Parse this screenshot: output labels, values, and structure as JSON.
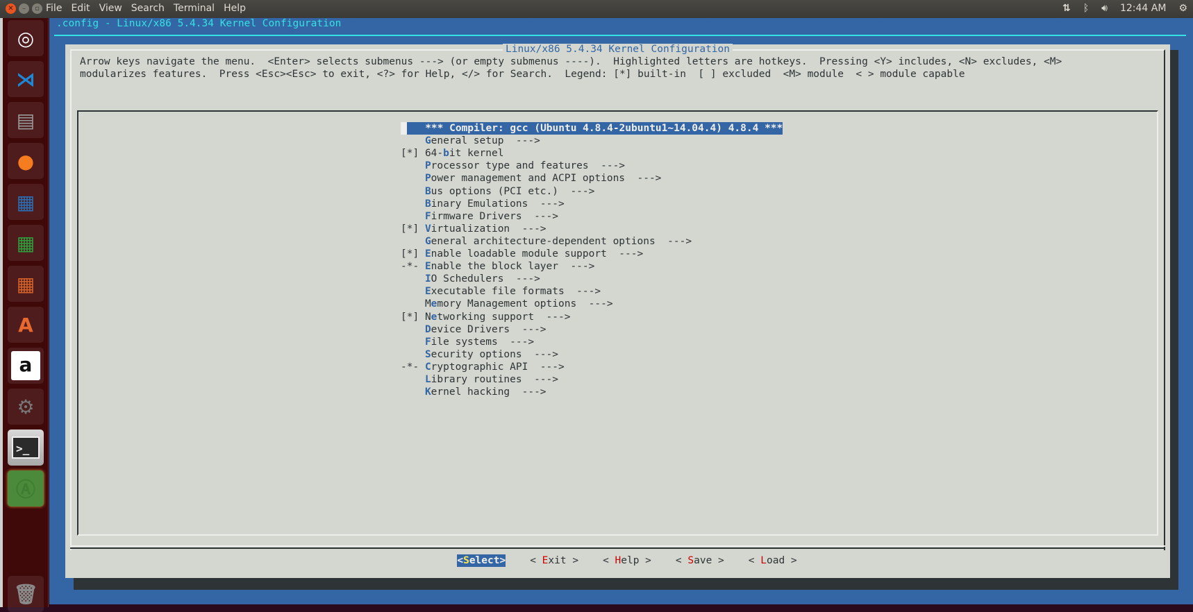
{
  "topbar": {
    "menus": [
      "File",
      "Edit",
      "View",
      "Search",
      "Terminal",
      "Help"
    ],
    "tray": {
      "network_icon": "network-updown-icon",
      "bluetooth_icon": "bluetooth-icon",
      "volume_icon": "volume-icon",
      "clock": "12:44 AM",
      "power_icon": "power-gear-icon"
    }
  },
  "launcher": {
    "items": [
      {
        "name": "ubuntu-dash",
        "icon": "ubuntu-logo-icon",
        "color": "#b03a3a"
      },
      {
        "name": "vscode",
        "icon": "vscode-icon",
        "color": "#1e88d8"
      },
      {
        "name": "files",
        "icon": "file-cabinet-icon",
        "color": "#9a9a9a"
      },
      {
        "name": "firefox",
        "icon": "firefox-icon",
        "color": "#f57c1f"
      },
      {
        "name": "libreoffice-writer",
        "icon": "writer-icon",
        "color": "#2a6fb5"
      },
      {
        "name": "libreoffice-calc",
        "icon": "calc-icon",
        "color": "#2f9e3c"
      },
      {
        "name": "libreoffice-impress",
        "icon": "impress-icon",
        "color": "#d4632a"
      },
      {
        "name": "software-center",
        "icon": "shopping-bag-icon",
        "color": "#e8692d"
      },
      {
        "name": "amazon",
        "icon": "amazon-icon",
        "color": "#dddddd"
      },
      {
        "name": "system-settings",
        "icon": "settings-wrench-icon",
        "color": "#777777"
      },
      {
        "name": "terminal",
        "icon": "terminal-icon",
        "color": "#2b2b2b"
      },
      {
        "name": "software-updater",
        "icon": "updater-icon",
        "color": "#3f7d32"
      },
      {
        "name": "trash",
        "icon": "trash-icon",
        "color": "#8a8a8a"
      }
    ]
  },
  "window": {
    "title": ".config - Linux/x86 5.4.34 Kernel Configuration"
  },
  "dialog": {
    "title": "Linux/x86 5.4.34 Kernel Configuration",
    "help_lines": [
      "Arrow keys navigate the menu.  <Enter> selects submenus ---> (or empty submenus ----).  Highlighted letters are hotkeys.  Pressing <Y> includes, <N> excludes, <M>",
      "modularizes features.  Press <Esc><Esc> to exit, <?> for Help, </> for Search.  Legend: [*] built-in  [ ] excluded  <M> module  < > module capable"
    ],
    "selected_item": "*** Compiler: gcc (Ubuntu 4.8.4-2ubuntu1~14.04.4) 4.8.4 ***",
    "items": [
      {
        "prefix": "   ",
        "before": "",
        "hotkey": "G",
        "after": "eneral setup  --->"
      },
      {
        "prefix": "[*]",
        "before": "64-",
        "hotkey": "b",
        "after": "it kernel"
      },
      {
        "prefix": "   ",
        "before": "",
        "hotkey": "P",
        "after": "rocessor type and features  --->"
      },
      {
        "prefix": "   ",
        "before": "",
        "hotkey": "P",
        "after": "ower management and ACPI options  --->"
      },
      {
        "prefix": "   ",
        "before": "",
        "hotkey": "B",
        "after": "us options (PCI etc.)  --->"
      },
      {
        "prefix": "   ",
        "before": "",
        "hotkey": "B",
        "after": "inary Emulations  --->"
      },
      {
        "prefix": "   ",
        "before": "",
        "hotkey": "F",
        "after": "irmware Drivers  --->"
      },
      {
        "prefix": "[*]",
        "before": "",
        "hotkey": "V",
        "after": "irtualization  --->"
      },
      {
        "prefix": "   ",
        "before": "",
        "hotkey": "G",
        "after": "eneral architecture-dependent options  --->"
      },
      {
        "prefix": "[*]",
        "before": "",
        "hotkey": "E",
        "after": "nable loadable module support  --->"
      },
      {
        "prefix": "-*-",
        "before": "",
        "hotkey": "E",
        "after": "nable the block layer  --->"
      },
      {
        "prefix": "   ",
        "before": "",
        "hotkey": "I",
        "after": "O Schedulers  --->"
      },
      {
        "prefix": "   ",
        "before": "",
        "hotkey": "E",
        "after": "xecutable file formats  --->"
      },
      {
        "prefix": "   ",
        "before": "M",
        "hotkey": "e",
        "after": "mory Management options  --->"
      },
      {
        "prefix": "[*]",
        "before": "N",
        "hotkey": "e",
        "after": "tworking support  --->"
      },
      {
        "prefix": "   ",
        "before": "",
        "hotkey": "D",
        "after": "evice Drivers  --->"
      },
      {
        "prefix": "   ",
        "before": "",
        "hotkey": "F",
        "after": "ile systems  --->"
      },
      {
        "prefix": "   ",
        "before": "",
        "hotkey": "S",
        "after": "ecurity options  --->"
      },
      {
        "prefix": "-*-",
        "before": "",
        "hotkey": "C",
        "after": "ryptographic API  --->"
      },
      {
        "prefix": "   ",
        "before": "",
        "hotkey": "L",
        "after": "ibrary routines  --->"
      },
      {
        "prefix": "   ",
        "before": "",
        "hotkey": "K",
        "after": "ernel hacking  --->"
      }
    ],
    "buttons": [
      {
        "pre": "<",
        "hotkey": "S",
        "post": "elect>",
        "selected": true
      },
      {
        "pre": "< ",
        "hotkey": "E",
        "post": "xit >",
        "selected": false
      },
      {
        "pre": "< ",
        "hotkey": "H",
        "post": "elp >",
        "selected": false
      },
      {
        "pre": "< ",
        "hotkey": "S",
        "post": "ave >",
        "selected": false
      },
      {
        "pre": "< ",
        "hotkey": "L",
        "post": "oad >",
        "selected": false
      }
    ]
  },
  "colors": {
    "terminal_bg": "#3465a4",
    "dialog_bg": "#d3d7cf",
    "title_cyan": "#34e2e2",
    "hotkey_blue": "#3465a4",
    "button_hotkey_red": "#cc0000",
    "selected_hotkey_yellow": "#fce94f"
  }
}
